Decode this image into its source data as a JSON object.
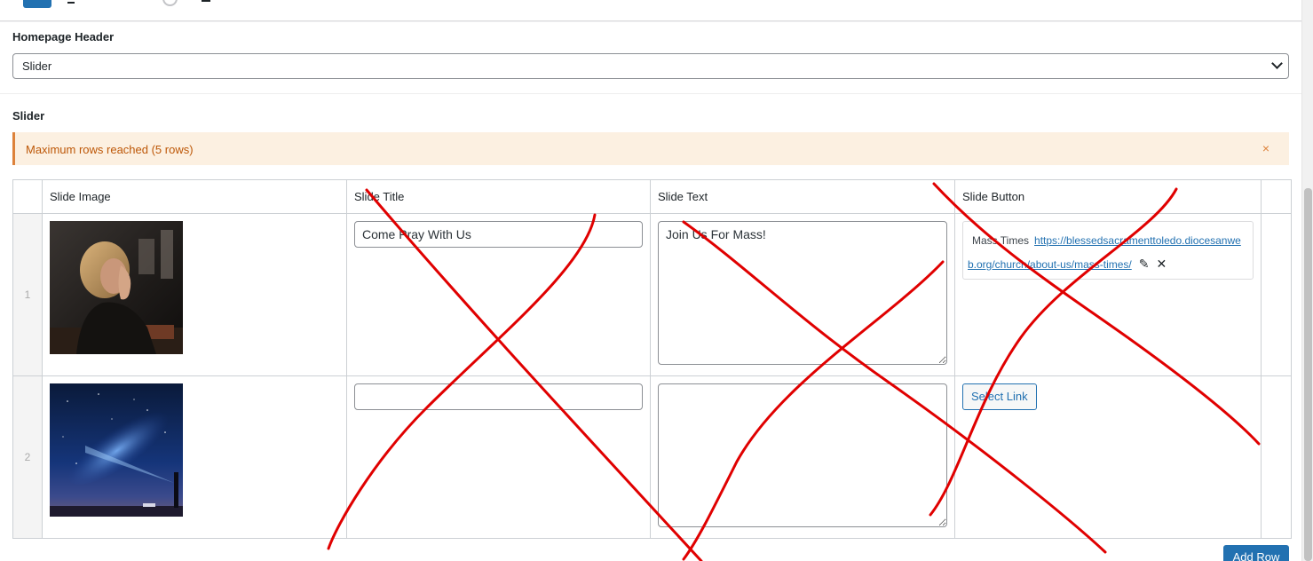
{
  "homepage_header": {
    "label": "Homepage Header",
    "selected": "Slider"
  },
  "slider": {
    "label": "Slider",
    "notice": "Maximum rows reached (5 rows)",
    "notice_close": "×",
    "columns": [
      "Slide Image",
      "Slide Title",
      "Slide Text",
      "Slide Button"
    ],
    "rows": [
      {
        "order": "1",
        "title": "Come Pray With Us",
        "text": "Join Us For Mass!",
        "button_title": "Mass Times",
        "button_url": "https://blessedsacramenttoledo.diocesanweb.org/church/about-us/mass-times/"
      },
      {
        "order": "2",
        "title": "",
        "text": "",
        "select_link_label": "Select Link"
      }
    ],
    "add_row_label": "Add Row"
  },
  "icons": {
    "edit": "pencil-icon",
    "remove": "close-icon",
    "dropdown": "chevron-down-icon"
  },
  "colors": {
    "accent": "#2271b1",
    "notice_bg": "#fcf0e1",
    "notice_border": "#dd823b",
    "scribble": "#e00000"
  }
}
